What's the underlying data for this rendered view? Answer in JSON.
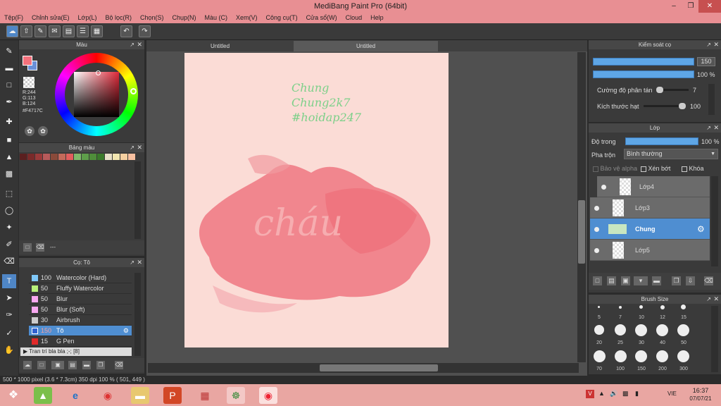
{
  "app": {
    "title": "MediBang Paint Pro (64bit)"
  },
  "menu": [
    "Tệp(F)",
    "Chỉnh sửa(E)",
    "Lớp(L)",
    "Bộ lọc(R)",
    "Chọn(S)",
    "Chụp(N)",
    "Màu (C)",
    "Xem(V)",
    "Công cụ(T)",
    "Cửa sổ(W)",
    "Cloud",
    "Help"
  ],
  "color_panel": {
    "title": "Màu",
    "r": "R:244",
    "g": "G:113",
    "b": "B:124",
    "hex": "#F4717C",
    "fg": "#F4717C"
  },
  "palette_panel": {
    "title": "Bảng màu",
    "swatches": [
      "#5a1f1f",
      "#7a2a2a",
      "#9a3a3a",
      "#b75a5a",
      "#8a4a3a",
      "#c46a5a",
      "#e25d5d",
      "#7fb96a",
      "#5e9e4a",
      "#4f8e3a",
      "#3a7a2a",
      "#e8e0c8",
      "#f2e6b0",
      "#f6d0a0",
      "#f8c0a0"
    ],
    "footer": "---"
  },
  "brush_panel": {
    "title": "Cọ: Tô",
    "items": [
      {
        "size": "100",
        "name": "Watercolor (Hard)",
        "color": "#7fc8f8"
      },
      {
        "size": "50",
        "name": "Fluffy Watercolor",
        "color": "#b8f07a"
      },
      {
        "size": "50",
        "name": "Blur",
        "color": "#f8a8f0"
      },
      {
        "size": "50",
        "name": "Blur (Soft)",
        "color": "#f8a8f0"
      },
      {
        "size": "30",
        "name": "Airbrush",
        "color": "#cccccc"
      },
      {
        "size": "150",
        "name": "Tô",
        "color": "#3060d0"
      },
      {
        "size": "15",
        "name": "G Pen",
        "color": "#e02a2a"
      }
    ],
    "group": "Tran trí bla bla ;-; [8]"
  },
  "tabs": [
    "Untitled",
    "Untitled"
  ],
  "canvas_text": [
    "Chung",
    "Chung2k7",
    "#hoidap247"
  ],
  "canvas_word": "cháu",
  "brush_control": {
    "title": "Kiểm soát cọ",
    "size": "150",
    "opacity": "100 %",
    "scatter_label": "Cường độ phân tán",
    "scatter_value": "7",
    "grain_label": "Kích thước hạt",
    "grain_value": "100"
  },
  "layer_panel": {
    "title": "Lớp",
    "opacity_label": "Độ trong",
    "opacity_value": "100 %",
    "blend_label": "Pha trộn",
    "blend_value": "Bình thường",
    "protect_alpha": "Bảo vệ alpha",
    "clip": "Xén bớt",
    "lock": "Khóa",
    "layers": [
      {
        "name": "Lớp4",
        "selected": false
      },
      {
        "name": "Lớp3",
        "selected": false
      },
      {
        "name": "Chung",
        "selected": true
      },
      {
        "name": "Lớp5",
        "selected": false
      }
    ]
  },
  "brush_size_panel": {
    "title": "Brush Size",
    "row1": [
      "5",
      "7",
      "10",
      "12",
      "15"
    ],
    "row2": [
      "20",
      "25",
      "30",
      "40",
      "50"
    ],
    "row3": [
      "70",
      "100",
      "150",
      "200",
      "300"
    ]
  },
  "status": {
    "text": "500 * 1000 pixel  (3.6 * 7.3cm)  350 dpi  100 %  ( 501, 449 )"
  },
  "taskbar": {
    "lang": "VIE",
    "time": "16:37",
    "date": "07/07/21"
  }
}
